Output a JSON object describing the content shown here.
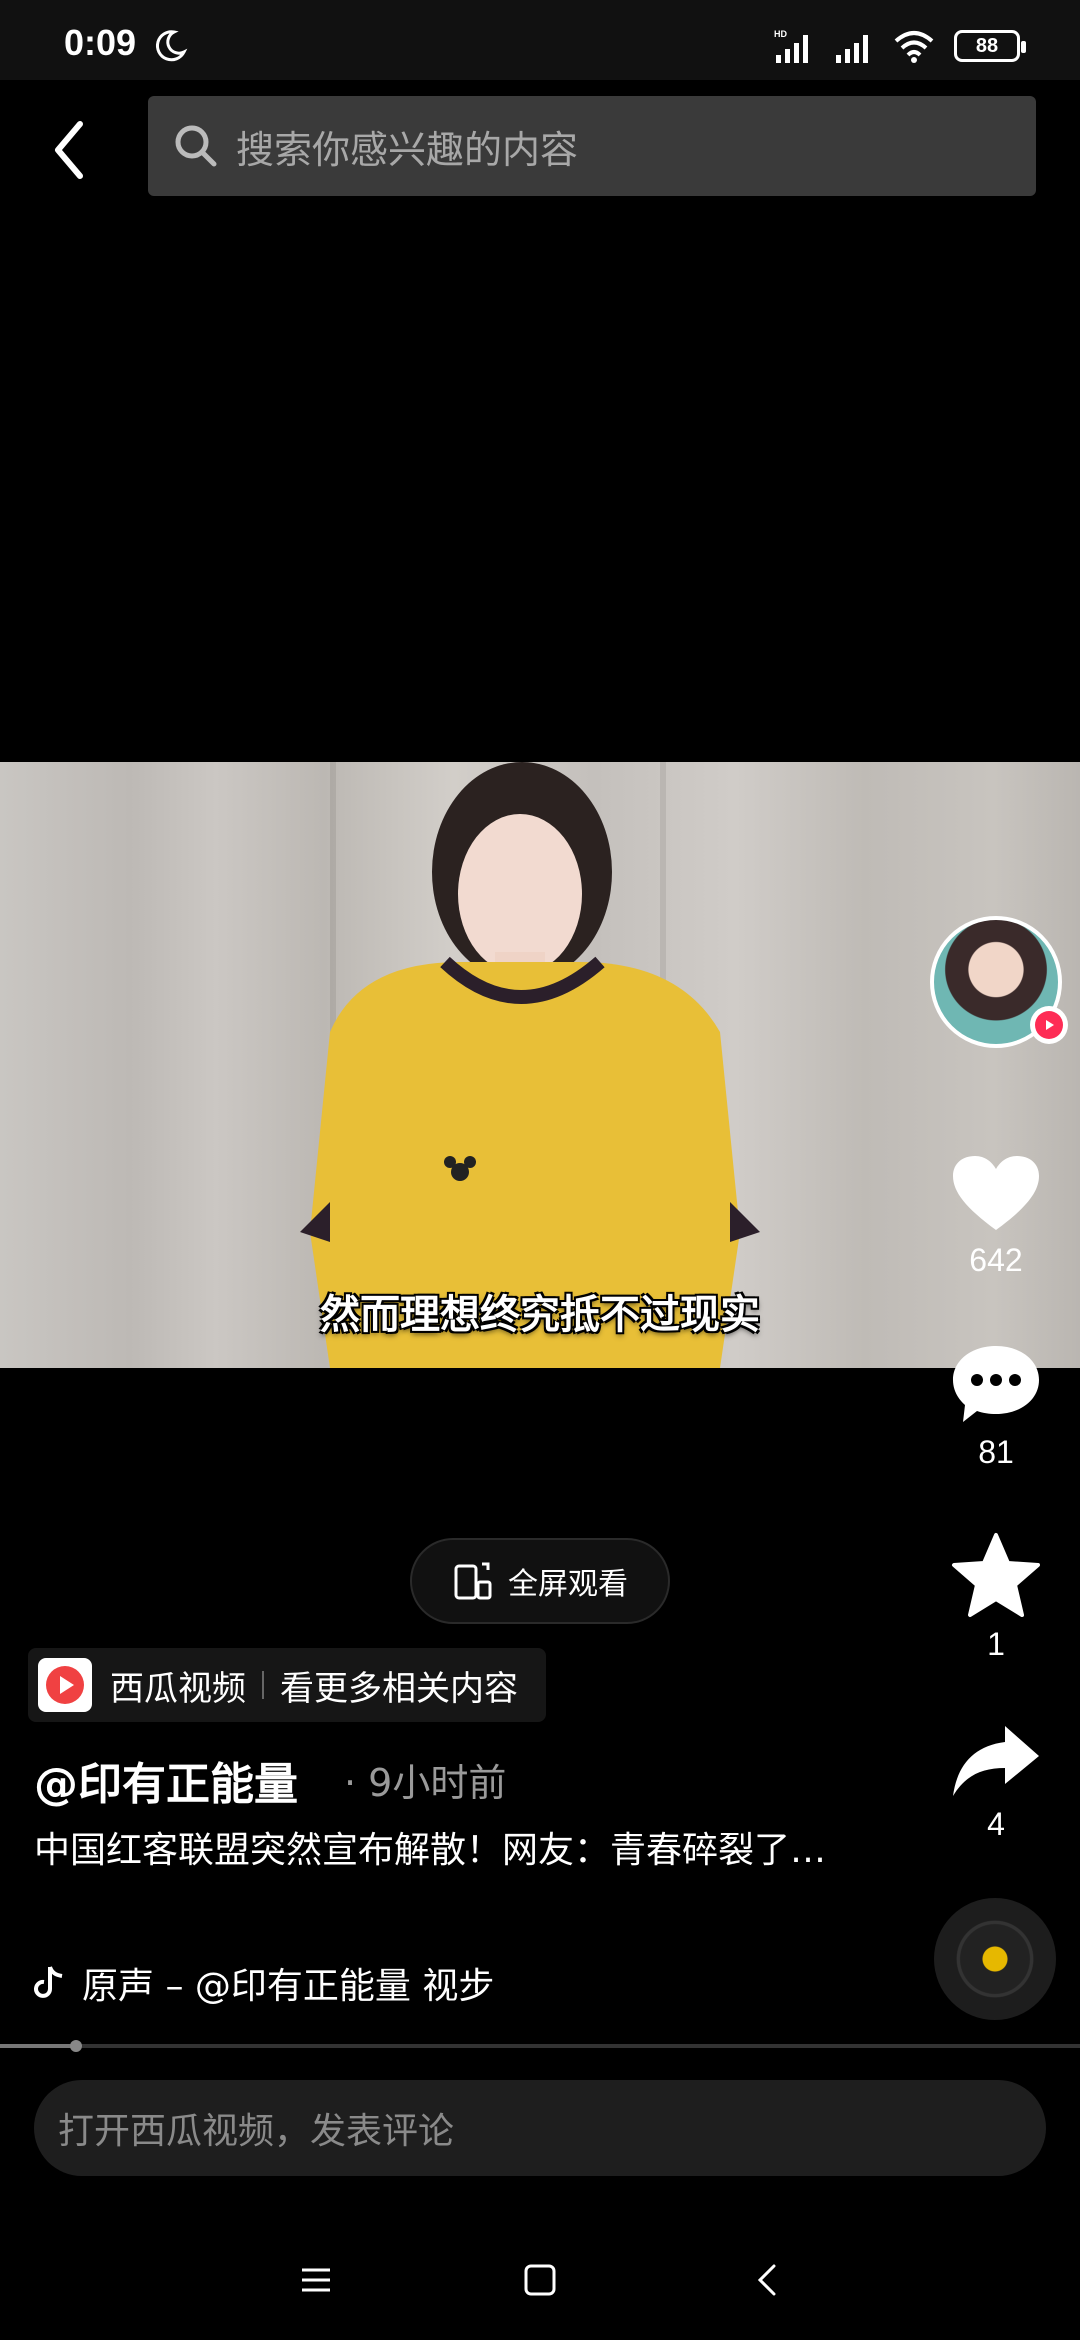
{
  "status_bar": {
    "time": "0:09",
    "network": "HD",
    "battery": "88"
  },
  "search": {
    "placeholder": "搜索你感兴趣的内容"
  },
  "video": {
    "subtitle": "然而理想终究抵不过现实"
  },
  "rail": {
    "likes": "642",
    "comments": "81",
    "favorites": "1",
    "shares": "4"
  },
  "fullscreen": {
    "label": "全屏观看"
  },
  "xigua": {
    "name": "西瓜视频",
    "more": "看更多相关内容"
  },
  "post": {
    "author": "@印有正能量",
    "time_ago": "· 9小时前",
    "description": "中国红客联盟突然宣布解散！网友：青春碎裂了…",
    "music": "原声 – @印有正能量    视步"
  },
  "progress": {
    "fraction": 0.07
  },
  "comment": {
    "placeholder": "打开西瓜视频，发表评论"
  },
  "colors": {
    "background": "#000000",
    "accent_red": "#fe2c55",
    "disc_center": "#e6b800"
  },
  "icons": [
    "moon-icon",
    "signal-icon",
    "wifi-icon",
    "back-icon",
    "search-icon",
    "heart-icon",
    "comment-icon",
    "star-icon",
    "share-icon",
    "tiktok-note-icon",
    "fullscreen-icon",
    "menu-icon",
    "home-icon",
    "nav-back-icon"
  ]
}
